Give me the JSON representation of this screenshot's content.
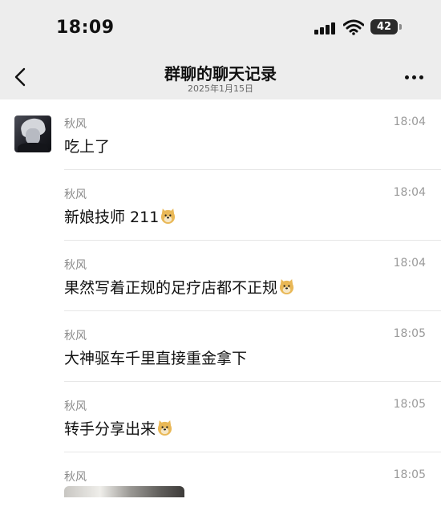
{
  "status_bar": {
    "time": "18:09",
    "battery": "42"
  },
  "header": {
    "title": "群聊的聊天记录",
    "subtitle": "2025年1月15日"
  },
  "messages": [
    {
      "sender": "秋风",
      "time": "18:04",
      "text": "吃上了",
      "emoji": false
    },
    {
      "sender": "秋风",
      "time": "18:04",
      "text": "新娘技师 211",
      "emoji": true
    },
    {
      "sender": "秋风",
      "time": "18:04",
      "text": "果然写着正规的足疗店都不正规",
      "emoji": true
    },
    {
      "sender": "秋风",
      "time": "18:05",
      "text": "大神驱车千里直接重金拿下",
      "emoji": false
    },
    {
      "sender": "秋风",
      "time": "18:05",
      "text": "转手分享出来",
      "emoji": true
    },
    {
      "sender": "秋风",
      "time": "18:05",
      "text": "",
      "emoji": false
    }
  ],
  "icons": {
    "back": "chevron-left-icon",
    "more": "more-dots-icon",
    "emoji": "doge-emoji-icon",
    "signal": "signal-icon",
    "wifi": "wifi-icon",
    "battery": "battery-icon"
  },
  "colors": {
    "bar_background": "#ededed",
    "divider": "#e6e6e6",
    "meta_text": "#8a8a8a"
  }
}
